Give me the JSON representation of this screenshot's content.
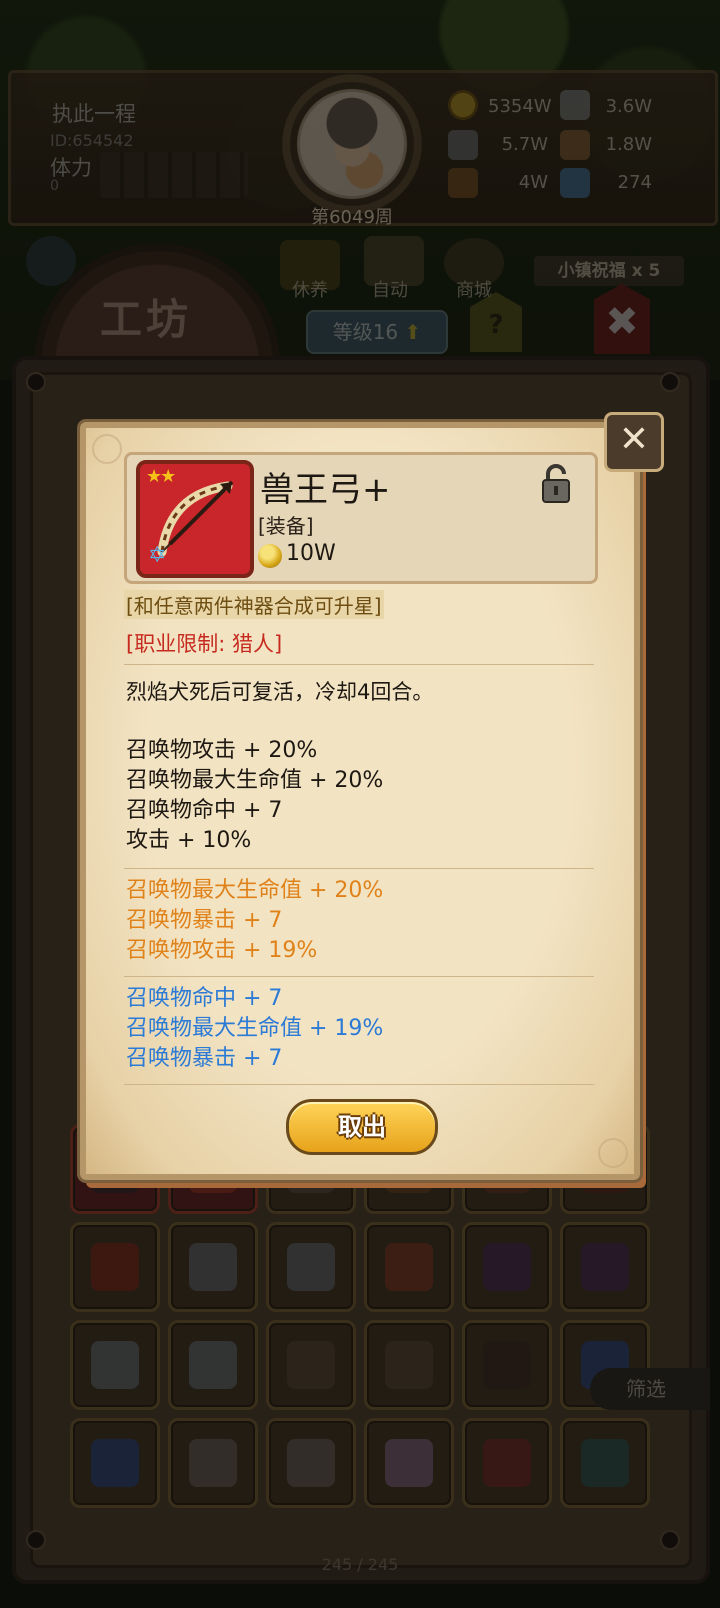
{
  "player": {
    "name": "执此一程",
    "id": "ID:654542",
    "stamina_label": "体力",
    "stamina_value": "0",
    "week": "第6049周"
  },
  "resources": [
    {
      "icon": "gold-coin-icon",
      "value": "5354W"
    },
    {
      "icon": "iron-ingot-icon",
      "value": "3.6W"
    },
    {
      "icon": "stone-ore-icon",
      "value": "5.7W"
    },
    {
      "icon": "leather-icon",
      "value": "1.8W"
    },
    {
      "icon": "wood-log-icon",
      "value": "4W"
    },
    {
      "icon": "crystal-icon",
      "value": "274"
    }
  ],
  "nav": {
    "workshop": "工坊",
    "level": "等级16",
    "rest": "休养",
    "auto": "自动",
    "shop": "商城",
    "town_blessing": "小镇祝福 x 5",
    "help": "?"
  },
  "item": {
    "name": "兽王弓+",
    "type": "[装备]",
    "price": "10W",
    "stars": "★★",
    "merge_note": "[和任意两件神器合成可升星]",
    "class_limit": "[职业限制: 猎人]",
    "description": "烈焰犬死后可复活，冷却4回合。",
    "base_stats": [
      "召唤物攻击 + 20%",
      "召唤物最大生命值 + 20%",
      "召唤物命中 + 7",
      "攻击 + 10%"
    ],
    "orange_stats": [
      "召唤物最大生命值 + 20%",
      "召唤物暴击 + 7",
      "召唤物攻击 + 19%"
    ],
    "blue_stats": [
      "召唤物命中 + 7",
      "召唤物最大生命值 + 19%",
      "召唤物暴击 + 7"
    ],
    "take_button": "取出"
  },
  "inventory": {
    "filter_label": "筛选",
    "page_count": "245 / 245"
  },
  "colors": {
    "orange_stat": "#e0821a",
    "blue_stat": "#2a7ad6",
    "class_limit_red": "#c62a1f"
  }
}
